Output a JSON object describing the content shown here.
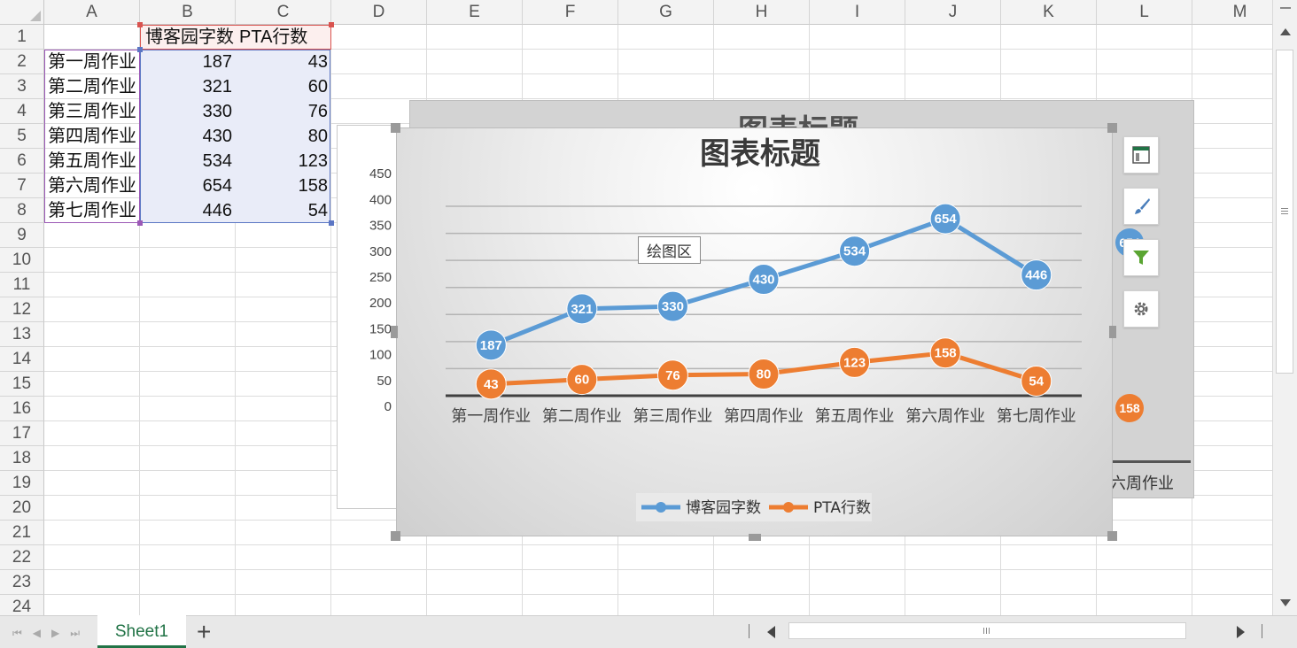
{
  "columns": [
    "A",
    "B",
    "C",
    "D",
    "E",
    "F",
    "G",
    "H",
    "I",
    "J",
    "K",
    "L",
    "M"
  ],
  "rows": [
    "1",
    "2",
    "3",
    "4",
    "5",
    "6",
    "7",
    "8",
    "9",
    "10",
    "11",
    "12",
    "13",
    "14",
    "15",
    "16",
    "17",
    "18",
    "19",
    "20",
    "21",
    "22",
    "23",
    "24"
  ],
  "table": {
    "header": [
      "",
      "博客园字数",
      "PTA行数"
    ],
    "data": [
      [
        "第一周作业",
        "187",
        "43"
      ],
      [
        "第二周作业",
        "321",
        "60"
      ],
      [
        "第三周作业",
        "330",
        "76"
      ],
      [
        "第四周作业",
        "430",
        "80"
      ],
      [
        "第五周作业",
        "534",
        "123"
      ],
      [
        "第六周作业",
        "654",
        "158"
      ],
      [
        "第七周作业",
        "446",
        "54"
      ]
    ]
  },
  "chart_data": {
    "type": "line",
    "title": "图表标题",
    "categories": [
      "第一周作业",
      "第二周作业",
      "第三周作业",
      "第四周作业",
      "第五周作业",
      "第六周作业",
      "第七周作业"
    ],
    "series": [
      {
        "name": "博客园字数",
        "values": [
          187,
          321,
          330,
          430,
          534,
          654,
          446
        ],
        "color": "#5b9bd5"
      },
      {
        "name": "PTA行数",
        "values": [
          43,
          60,
          76,
          80,
          123,
          158,
          54
        ],
        "color": "#ed7d31"
      }
    ],
    "yticks": [
      "0",
      "50",
      "100",
      "150",
      "200",
      "250",
      "300",
      "350",
      "400",
      "450"
    ],
    "legend": "bottom",
    "grid": true
  },
  "tooltip": "绘图区",
  "ghost": {
    "title": "图表标题",
    "label_654": "654",
    "label_158": "158",
    "axis_label": "六周作业"
  },
  "sheet_tab": "Sheet1",
  "add_tab": "+",
  "side_buttons": [
    "chart-elements-icon",
    "chart-styles-icon",
    "chart-filter-icon",
    "chart-settings-icon"
  ]
}
